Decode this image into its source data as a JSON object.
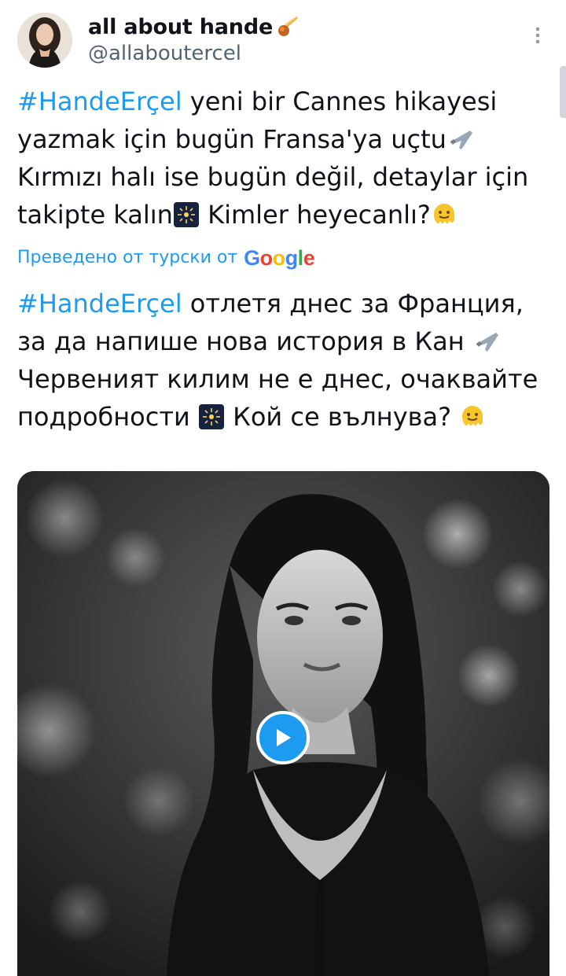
{
  "author": {
    "display_name": "all about hande",
    "handle": "@allaboutercel",
    "name_emoji_icon": "comet-icon"
  },
  "tweet": {
    "hashtag": "#HandeErçel",
    "line_rest_1": " yeni bir Cannes hikayesi yazmak için bugün Fransa'ya uçtu",
    "line_rest_2": " Kırmızı halı ise bugün değil, detaylar için takipte kalın",
    "line_rest_3": " Kimler heyecanlı?"
  },
  "translation": {
    "note": "Преведено от турски от",
    "provider": "Google",
    "hashtag": "#HandeErçel",
    "part_1": " отлетя днес за Франция, за да напише нова история в Кан ",
    "part_2": " Червеният килим не е днес, очаквайте подробности ",
    "part_3": " Кой се вълнува? "
  },
  "media": {
    "type": "video",
    "play_icon": "play-icon"
  },
  "colors": {
    "link": "#1d9bf0",
    "secondary_text": "#536471",
    "primary_text": "#0f1419"
  }
}
